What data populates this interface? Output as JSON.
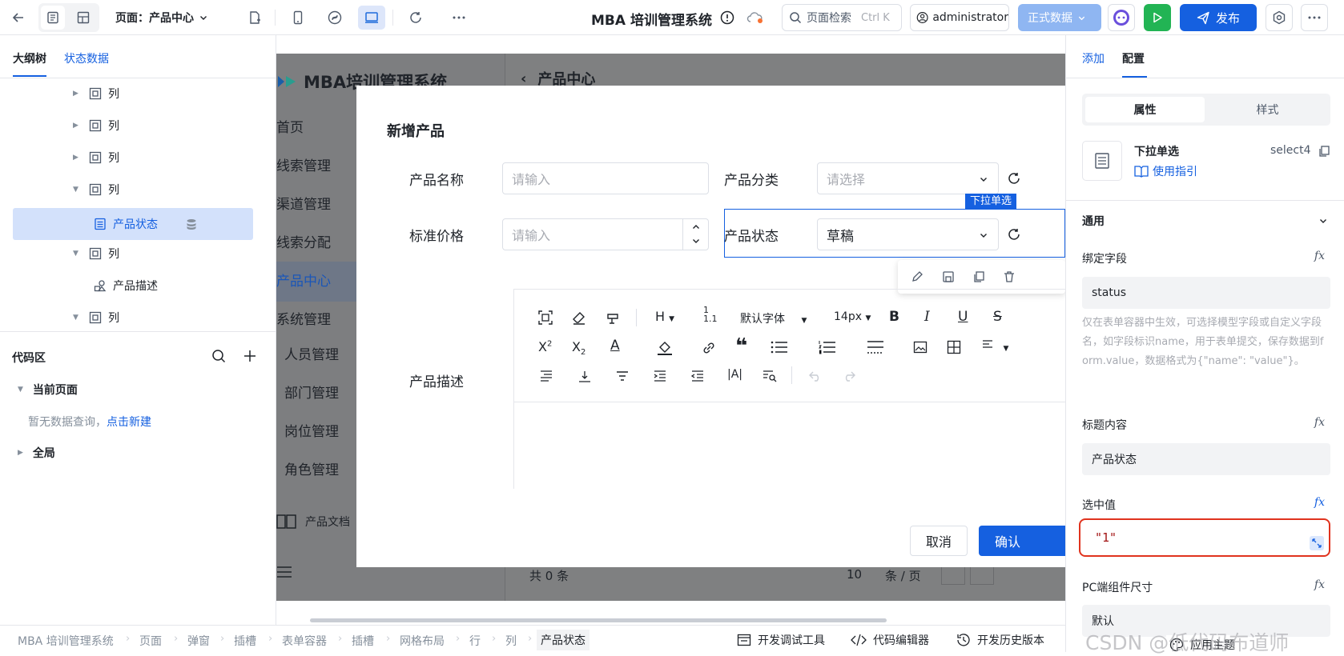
{
  "topbar": {
    "page_label": "页面：产品中心",
    "app_title": "MBA 培训管理系统",
    "search_placeholder": "页面检索",
    "search_shortcut": "Ctrl K",
    "user": "administrator",
    "env": "正式数据",
    "publish": "发布"
  },
  "left": {
    "tabs": [
      "大纲树",
      "状态数据"
    ],
    "tree": [
      {
        "label": "列"
      },
      {
        "label": "列"
      },
      {
        "label": "列"
      },
      {
        "label": "列"
      },
      {
        "label": "产品状态"
      },
      {
        "label": "列"
      },
      {
        "label": "产品描述"
      },
      {
        "label": "列"
      }
    ],
    "code": {
      "title": "代码区",
      "current_page": "当前页面",
      "empty_text": "暂无数据查询，",
      "create_link": "点击新建",
      "global": "全局"
    }
  },
  "background": {
    "logo": "MBA培训管理系统",
    "header": "产品中心",
    "nav": [
      "首页",
      "线索管理",
      "渠道管理",
      "线索分配",
      "产品中心",
      "系统管理",
      "人员管理",
      "部门管理",
      "岗位管理",
      "角色管理"
    ],
    "doc": "产品文档",
    "pager_total": "共 0 条",
    "pager_size": "10",
    "pager_unit": "条 / 页"
  },
  "modal": {
    "title": "新增产品",
    "name_label": "产品名称",
    "name_placeholder": "请输入",
    "category_label": "产品分类",
    "category_placeholder": "请选择",
    "price_label": "标准价格",
    "price_placeholder": "请输入",
    "status_label": "产品状态",
    "status_value": "草稿",
    "selection_tag": "下拉单选",
    "desc_label": "产品描述",
    "rte_font": "默认字体",
    "rte_size": "14px",
    "cancel": "取消",
    "confirm": "确认"
  },
  "right": {
    "tabs": [
      "添加",
      "配置"
    ],
    "seg": [
      "属性",
      "样式"
    ],
    "component_name": "下拉单选",
    "component_id": "select4",
    "guide": "使用指引",
    "section": "通用",
    "bind_label": "绑定字段",
    "bind_value": "status",
    "bind_hint": "仅在表单容器中生效，可选择模型字段或自定义字段名，如字段标识name，用于表单提交，保存数据到form.value，数据格式为{\"name\": \"value\"}。",
    "title_label": "标题内容",
    "title_value": "产品状态",
    "selected_label": "选中值",
    "selected_value": "\"1\"",
    "size_label": "PC端组件尺寸",
    "size_value": "默认",
    "fx": "fx"
  },
  "bottom": {
    "crumbs": [
      "MBA 培训管理系统",
      "页面",
      "弹窗",
      "插槽",
      "表单容器",
      "插槽",
      "网格布局",
      "行",
      "列",
      "产品状态"
    ],
    "tools": [
      "开发调试工具",
      "代码编辑器",
      "开发历史版本",
      "应用主题"
    ]
  },
  "watermark": "CSDN @低代码布道师"
}
